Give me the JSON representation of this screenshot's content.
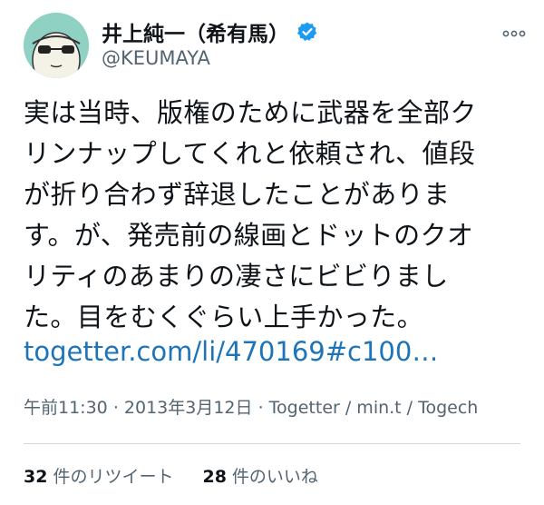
{
  "author": {
    "display_name": "井上純一（希有馬）",
    "handle": "@KEUMAYA",
    "verified": true
  },
  "tweet": {
    "lines": [
      "実は当時、版権のために武器を全部ク",
      "リンナップしてくれと依頼され、値段",
      "が折り合わず辞退したことがありま",
      "す。が、発売前の線画とドットのクオ",
      "リティのあまりの凄さにビビりまし",
      "た。目をむくぐらい上手かった。"
    ],
    "link": "togetter.com/li/470169#c100…"
  },
  "meta": {
    "time": "午前11:30",
    "date": "2013年3月12日",
    "source": "Togetter / min.t / Togech"
  },
  "stats": {
    "retweets_count": "32",
    "retweets_label": "件のリツイート",
    "likes_count": "28",
    "likes_label": "件のいいね"
  },
  "colors": {
    "link": "#1d74b8",
    "verified_badge": "#1d9bf0",
    "secondary_text": "#536471"
  },
  "icons": {
    "verified": "verified-badge-icon",
    "more": "more-options-icon"
  }
}
